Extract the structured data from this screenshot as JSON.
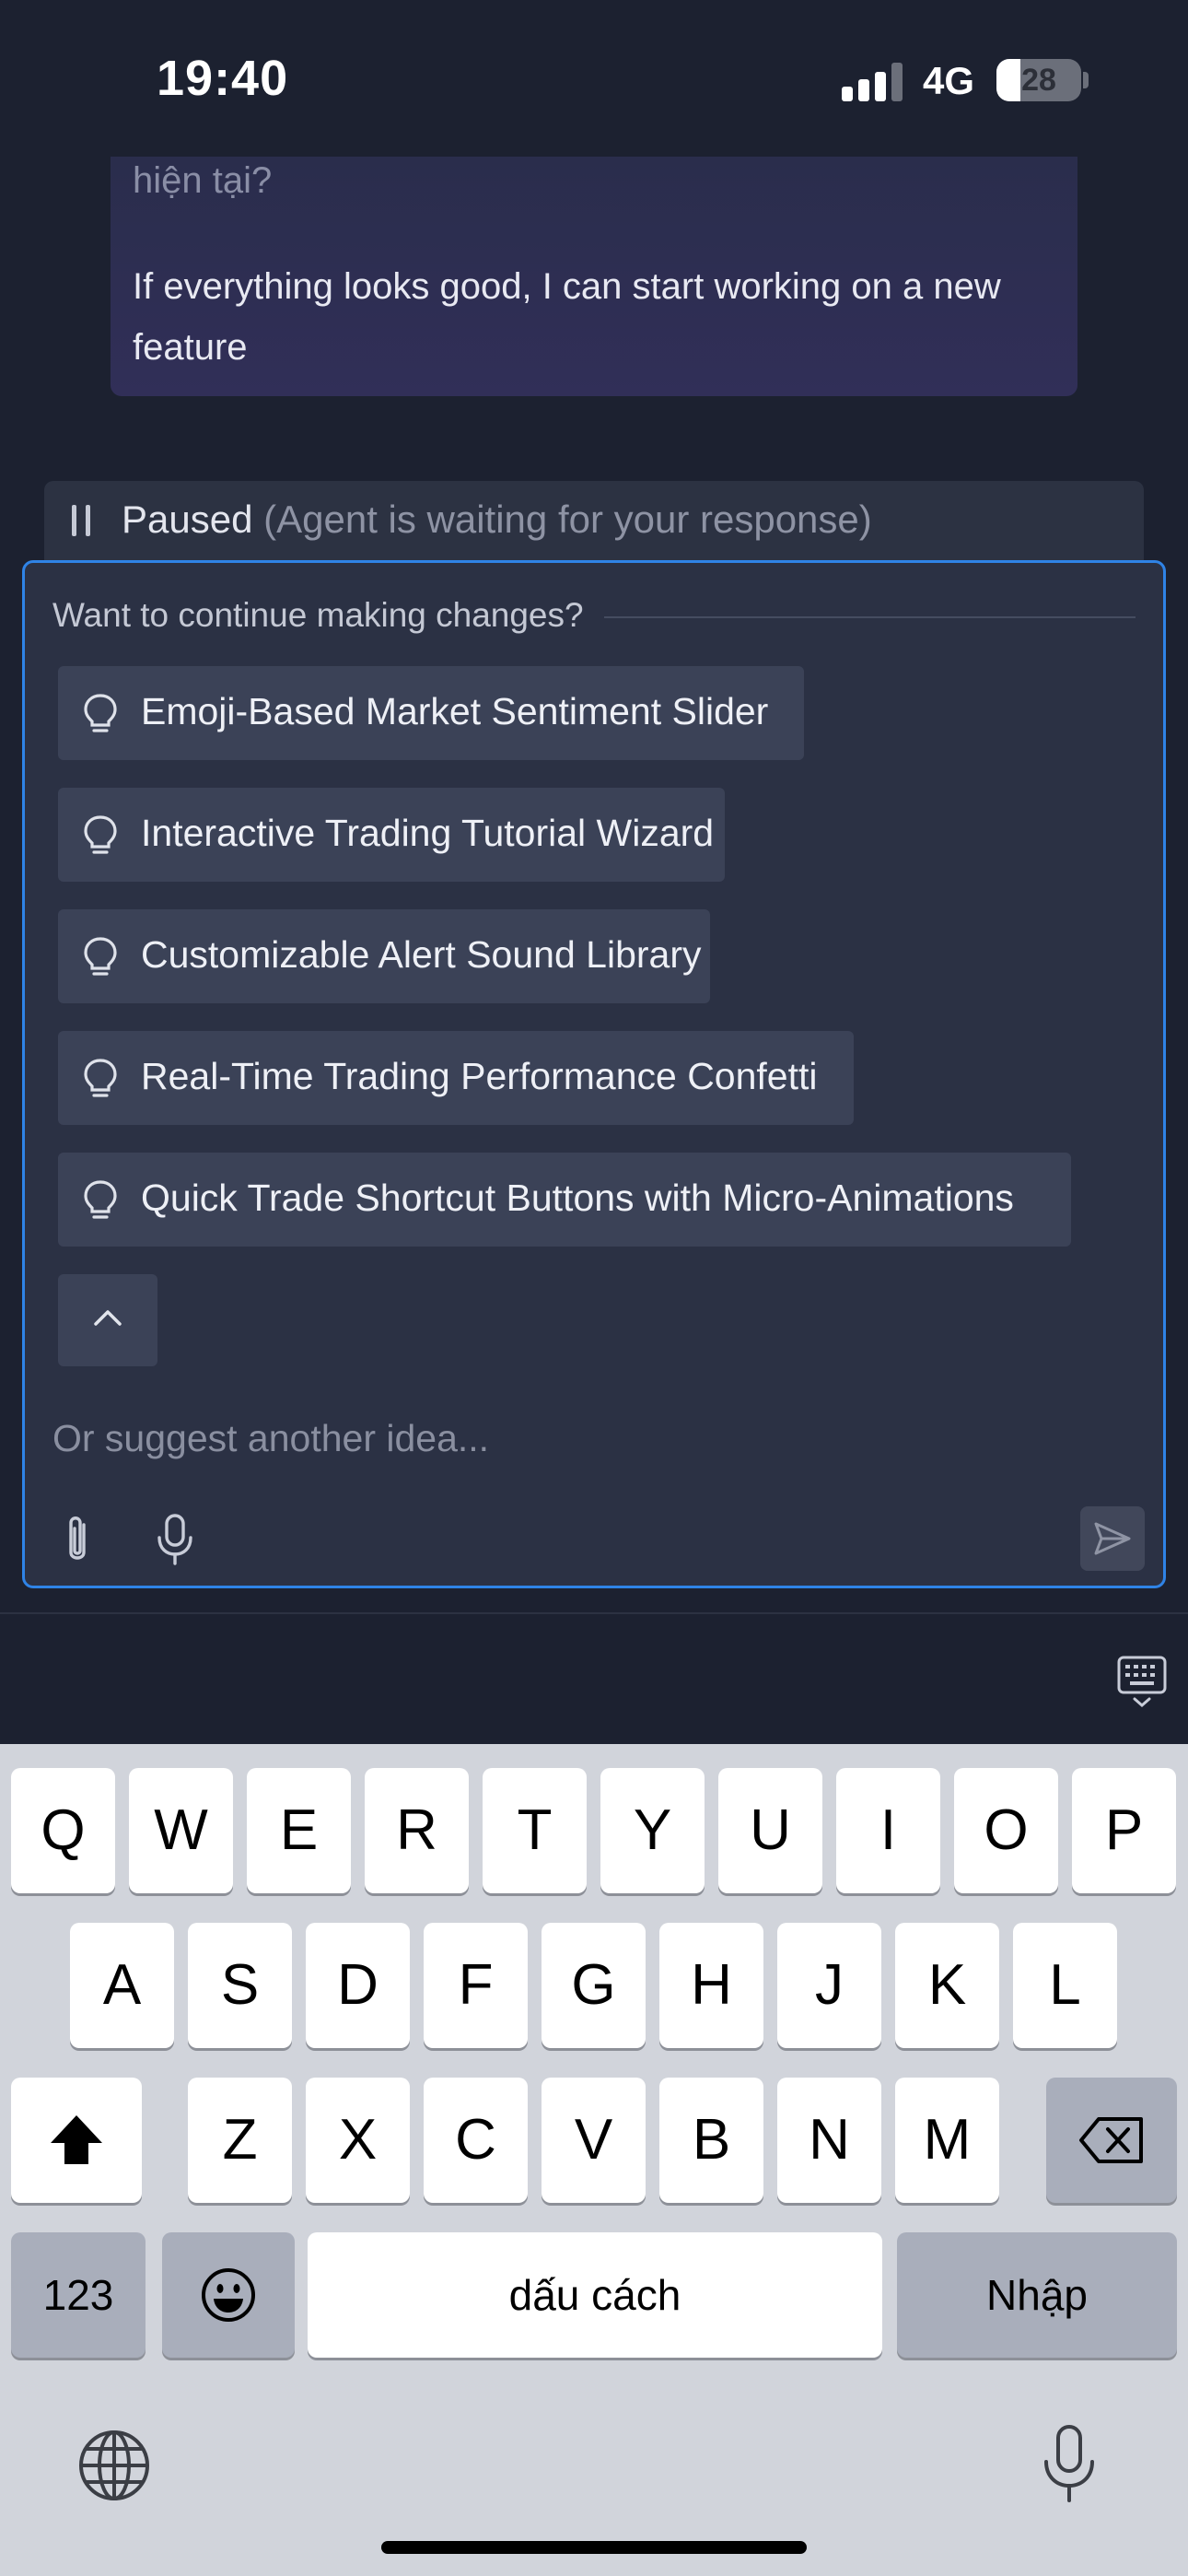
{
  "status_bar": {
    "time": "19:40",
    "network": "4G",
    "battery_level": "28",
    "battery_fraction": 0.28,
    "signal_bars_active": 3,
    "signal_bars_total": 4
  },
  "message": {
    "previous_line": "hiện tại?",
    "text": "If everything looks good, I can start working on a new feature"
  },
  "paused": {
    "icon": "pause-icon",
    "label": "Paused",
    "detail": "(Agent is waiting for your response)"
  },
  "suggestions": {
    "heading": "Want to continue making changes?",
    "icon": "lightbulb-icon",
    "items": [
      {
        "label": "Emoji-Based Market Sentiment Slider"
      },
      {
        "label": "Interactive Trading Tutorial Wizard"
      },
      {
        "label": "Customizable Alert Sound Library"
      },
      {
        "label": "Real-Time Trading Performance Confetti"
      },
      {
        "label": "Quick Trade Shortcut Buttons with Micro-Animations"
      }
    ],
    "collapse_icon": "chevron-up-icon"
  },
  "composer": {
    "placeholder": "Or suggest another idea...",
    "value": "",
    "attach_icon": "paperclip-icon",
    "mic_icon": "microphone-icon",
    "send_icon": "send-icon"
  },
  "keyboard": {
    "row1": [
      "Q",
      "W",
      "E",
      "R",
      "T",
      "Y",
      "U",
      "I",
      "O",
      "P"
    ],
    "row2": [
      "A",
      "S",
      "D",
      "F",
      "G",
      "H",
      "J",
      "K",
      "L"
    ],
    "row3": [
      "Z",
      "X",
      "C",
      "V",
      "B",
      "N",
      "M"
    ],
    "numbers_key": "123",
    "space_key": "dấu cách",
    "return_key": "Nhập",
    "shift_icon": "shift-icon",
    "delete_icon": "backspace-icon",
    "emoji_icon": "emoji-icon",
    "globe_icon": "globe-icon",
    "dictation_icon": "microphone-icon"
  },
  "colors": {
    "background": "#1c2130",
    "panel": "#2b3144",
    "panel_border": "#2f83e6",
    "chip": "#3b4257",
    "message_bubble": "#2f2e55",
    "keyboard": "#d1d4db"
  }
}
